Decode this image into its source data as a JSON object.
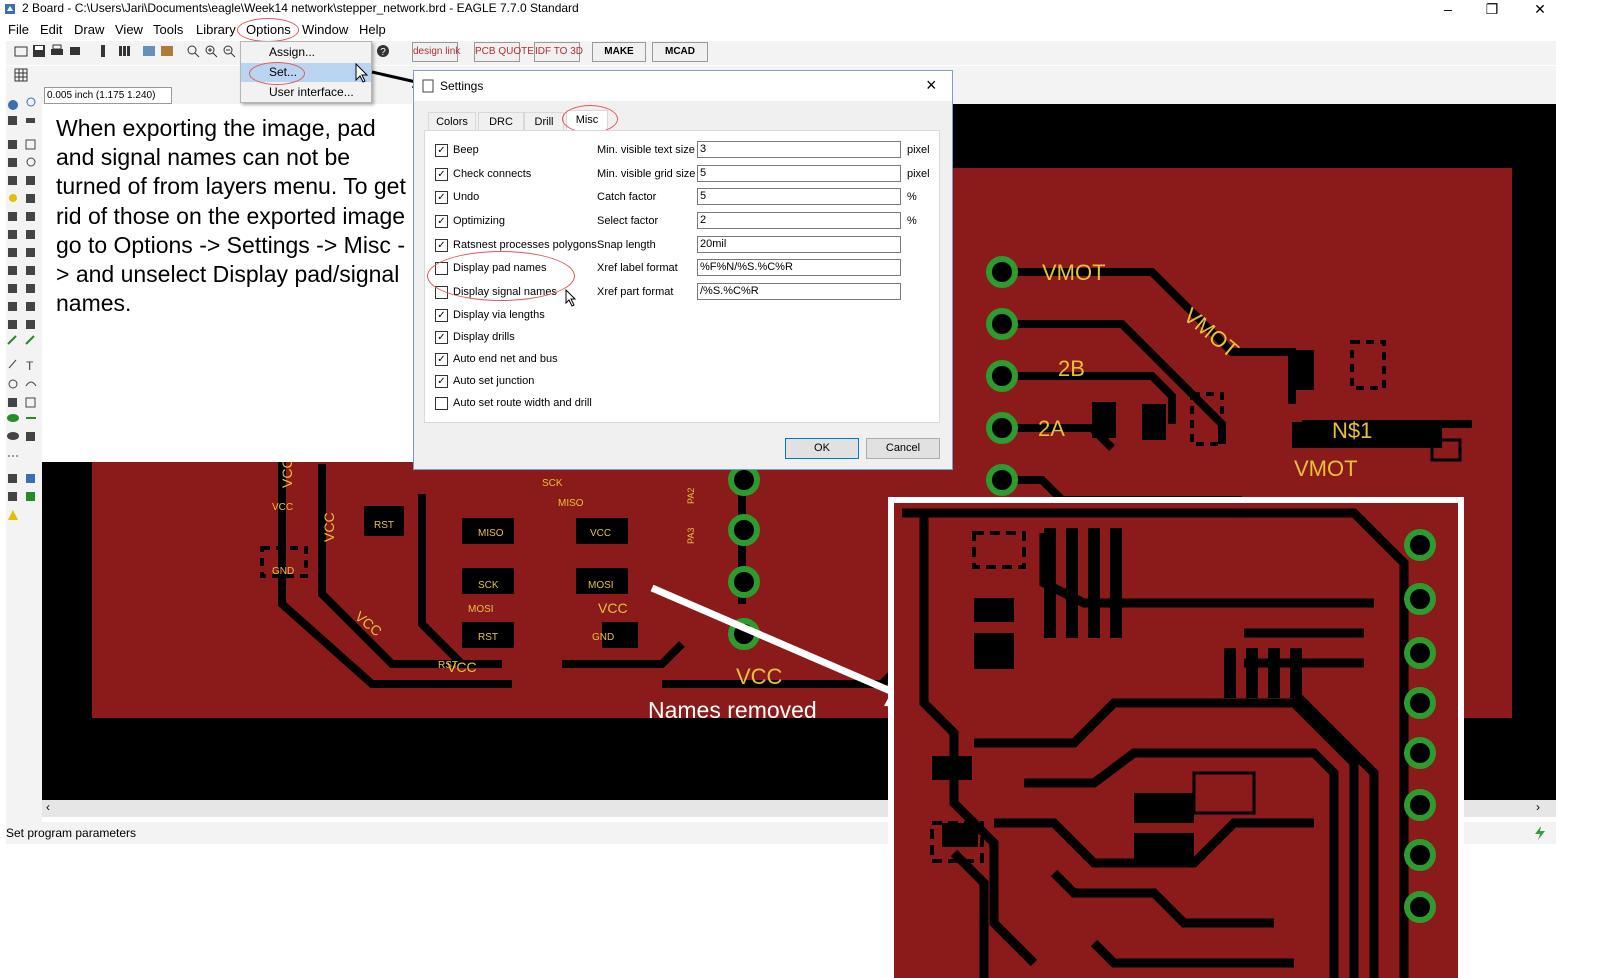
{
  "window": {
    "title": "2 Board - C:\\Users\\Jari\\Documents\\eagle\\Week14 network\\stepper_network.brd - EAGLE 7.7.0 Standard",
    "minimize_glyph": "–",
    "restore_glyph": "❐",
    "close_glyph": "✕"
  },
  "menubar": {
    "items": [
      "File",
      "Edit",
      "Draw",
      "View",
      "Tools",
      "Library",
      "Options",
      "Window",
      "Help"
    ]
  },
  "toolbar": {
    "buttons": [
      "design link",
      "PCB QUOTE",
      "IDF TO 3D",
      "MAKE",
      "MCAD"
    ]
  },
  "coordinate_display": "0.005 inch (1.175 1.240)",
  "options_menu": {
    "items": [
      "Assign...",
      "Set...",
      "User interface..."
    ]
  },
  "instruction_text": "When exporting the image, pad and signal names can not be turned of from layers menu. To get rid of those on the exported image go to Options -> Settings -> Misc -> and unselect Display pad/signal names.",
  "settings_dialog": {
    "title": "Settings",
    "tabs": [
      "Colors",
      "DRC",
      "Drill",
      "Misc"
    ],
    "active_tab": "Misc",
    "checkboxes": [
      {
        "label": "Beep",
        "checked": true
      },
      {
        "label": "Check connects",
        "checked": true
      },
      {
        "label": "Undo",
        "checked": true
      },
      {
        "label": "Optimizing",
        "checked": true
      },
      {
        "label": "Ratsnest processes polygons",
        "checked": true
      },
      {
        "label": "Display pad names",
        "checked": false
      },
      {
        "label": "Display signal names",
        "checked": false
      },
      {
        "label": "Display via lengths",
        "checked": true
      },
      {
        "label": "Display drills",
        "checked": true
      },
      {
        "label": "Auto end net and bus",
        "checked": true
      },
      {
        "label": "Auto set junction",
        "checked": true
      },
      {
        "label": "Auto set route width and drill",
        "checked": false
      }
    ],
    "fields": [
      {
        "label": "Min. visible text size",
        "value": "3",
        "unit": "pixel"
      },
      {
        "label": "Min. visible grid size",
        "value": "5",
        "unit": "pixel"
      },
      {
        "label": "Catch factor",
        "value": "5",
        "unit": "%"
      },
      {
        "label": "Select factor",
        "value": "2",
        "unit": "%"
      },
      {
        "label": "Snap length",
        "value": "20mil",
        "unit": ""
      },
      {
        "label": "Xref label format",
        "value": "%F%N/%S.%C%R",
        "unit": ""
      },
      {
        "label": "Xref part format",
        "value": "/%S.%C%R",
        "unit": ""
      }
    ],
    "ok_label": "OK",
    "cancel_label": "Cancel"
  },
  "board_labels": {
    "vmot": "VMOT",
    "b2": "2B",
    "a2": "2A",
    "n1": "N$1",
    "vcc": "VCC",
    "small": [
      "RST",
      "MISO",
      "SCK",
      "MOSI",
      "GND",
      "VCC",
      "PA2",
      "PA3"
    ]
  },
  "inset_caption": "Names removed",
  "status_text": "Set program parameters",
  "colors": {
    "board_red": "#8b1a1a",
    "copper_label": "#e8c13a",
    "pad_green": "#2e9b2e",
    "annotation_red": "#e05a5a"
  }
}
